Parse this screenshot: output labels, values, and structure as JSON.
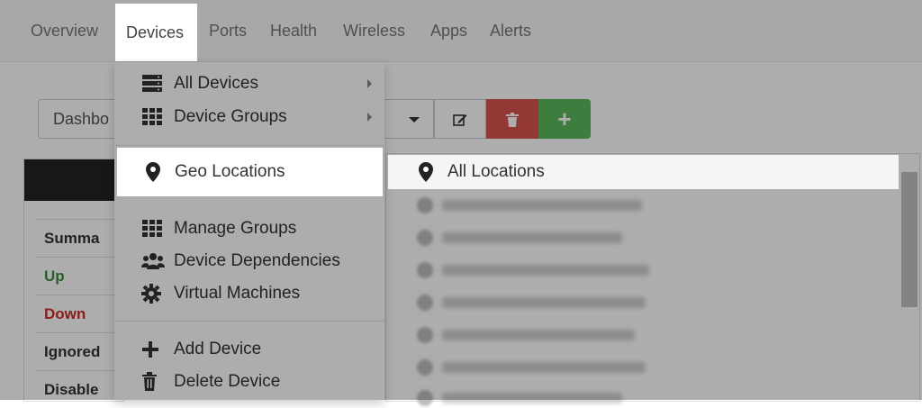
{
  "nav": {
    "items": [
      {
        "label": "Overview"
      },
      {
        "label": "Devices"
      },
      {
        "label": "Ports"
      },
      {
        "label": "Health"
      },
      {
        "label": "Wireless"
      },
      {
        "label": "Apps"
      },
      {
        "label": "Alerts"
      }
    ]
  },
  "dashboard": {
    "select_value": "Dashbo"
  },
  "summary": {
    "rows": [
      "Summa",
      "Up",
      "Down",
      "Ignored",
      "Disable"
    ]
  },
  "menu": {
    "all_devices": "All Devices",
    "device_groups": "Device Groups",
    "geo_locations": "Geo Locations",
    "manage_groups": "Manage Groups",
    "device_dependencies": "Device Dependencies",
    "virtual_machines": "Virtual Machines",
    "add_device": "Add Device",
    "delete_device": "Delete Device"
  },
  "submenu": {
    "all_locations": "All Locations"
  },
  "colors": {
    "delete": "#d9534f",
    "add": "#5cb85c",
    "up": "#3c8c3c",
    "down": "#c9302c"
  }
}
